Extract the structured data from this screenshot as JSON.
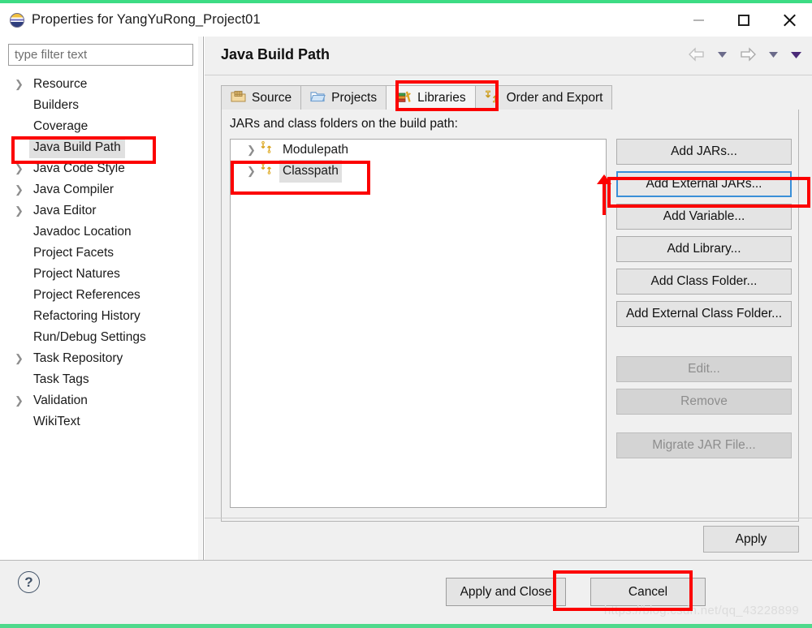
{
  "window": {
    "title": "Properties for YangYuRong_Project01",
    "icon": "eclipse-icon",
    "minimize_label": "—",
    "maximize_label": "□",
    "close_label": "✕"
  },
  "sidebar": {
    "filter": {
      "placeholder": "type filter text",
      "value": ""
    },
    "items": [
      {
        "label": "Resource",
        "expandable": true,
        "selected": false
      },
      {
        "label": "Builders",
        "expandable": false,
        "selected": false
      },
      {
        "label": "Coverage",
        "expandable": false,
        "selected": false
      },
      {
        "label": "Java Build Path",
        "expandable": false,
        "selected": true
      },
      {
        "label": "Java Code Style",
        "expandable": true,
        "selected": false
      },
      {
        "label": "Java Compiler",
        "expandable": true,
        "selected": false
      },
      {
        "label": "Java Editor",
        "expandable": true,
        "selected": false
      },
      {
        "label": "Javadoc Location",
        "expandable": false,
        "selected": false
      },
      {
        "label": "Project Facets",
        "expandable": false,
        "selected": false
      },
      {
        "label": "Project Natures",
        "expandable": false,
        "selected": false
      },
      {
        "label": "Project References",
        "expandable": false,
        "selected": false
      },
      {
        "label": "Refactoring History",
        "expandable": false,
        "selected": false
      },
      {
        "label": "Run/Debug Settings",
        "expandable": false,
        "selected": false
      },
      {
        "label": "Task Repository",
        "expandable": true,
        "selected": false
      },
      {
        "label": "Task Tags",
        "expandable": false,
        "selected": false
      },
      {
        "label": "Validation",
        "expandable": true,
        "selected": false
      },
      {
        "label": "WikiText",
        "expandable": false,
        "selected": false
      }
    ]
  },
  "header": {
    "title": "Java Build Path",
    "nav": {
      "back_icon": "back-arrow-icon",
      "back_dropdown_icon": "chevron-down-icon",
      "forward_icon": "forward-arrow-icon",
      "forward_dropdown_icon": "chevron-down-icon",
      "menu_icon": "chevron-down-filled-icon"
    }
  },
  "tabs": [
    {
      "label": "Source",
      "icon": "source-folder-icon",
      "active": false
    },
    {
      "label": "Projects",
      "icon": "projects-folder-icon",
      "active": false
    },
    {
      "label": "Libraries",
      "icon": "libraries-books-icon",
      "active": true
    },
    {
      "label": "Order and Export",
      "icon": "order-arrows-icon",
      "active": false
    }
  ],
  "pane": {
    "label": "JARs and class folders on the build path:",
    "list": [
      {
        "label": "Modulepath",
        "icon": "path-arrows-icon",
        "expandable": true,
        "selected": false
      },
      {
        "label": "Classpath",
        "icon": "path-arrows-icon",
        "expandable": true,
        "selected": true
      }
    ],
    "buttons": [
      {
        "label": "Add JARs...",
        "state": "normal"
      },
      {
        "label": "Add External JARs...",
        "state": "focused"
      },
      {
        "label": "Add Variable...",
        "state": "normal"
      },
      {
        "label": "Add Library...",
        "state": "normal"
      },
      {
        "label": "Add Class Folder...",
        "state": "normal"
      },
      {
        "label": "Add External Class Folder...",
        "state": "normal"
      },
      {
        "label": "Edit...",
        "state": "disabled"
      },
      {
        "label": "Remove",
        "state": "disabled"
      },
      {
        "label": "Migrate JAR File...",
        "state": "disabled"
      }
    ],
    "apply_label": "Apply"
  },
  "footer": {
    "help_icon": "help-question-icon",
    "help_glyph": "?",
    "apply_and_close_label": "Apply and Close",
    "cancel_label": "Cancel",
    "watermark": "https://blog.csdn.net/qq_43228899"
  },
  "colors": {
    "annotation": "#fc0000",
    "focus_ring": "#3a8fd8",
    "strip": "#3ddc84",
    "selection": "#e0e0e0"
  }
}
